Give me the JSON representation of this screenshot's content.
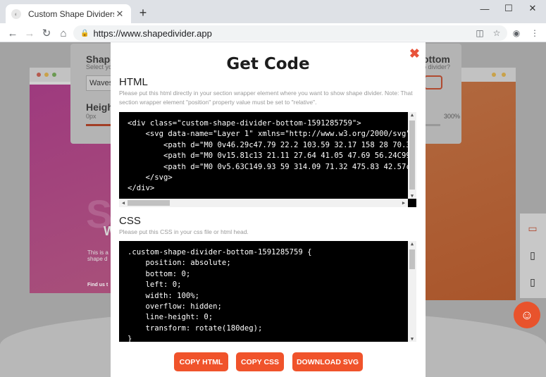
{
  "browser": {
    "tab_title": "Custom Shape Dividers",
    "url": "https://www.shapedivider.app",
    "new_tab_label": "+",
    "close_tab_label": "✕"
  },
  "background": {
    "shape_label": "Shape",
    "select_hint": "Select yo",
    "select_value": "Waves",
    "height_label": "Heigh",
    "height_min": "0px",
    "height_max": "300%",
    "bottom_label": "ottom",
    "bottom_hint": "o divider?",
    "hero_big": "S",
    "hero_w": "W",
    "hero_text": "This is a shape d",
    "hero_find": "Find us t"
  },
  "modal": {
    "title": "Get Code",
    "close_label": "✖",
    "html_heading": "HTML",
    "html_note": "Please put this html directly in your section wrapper element where you want to show shape divider. Note: That section wrapper element \"position\" property value must be set to \"relative\".",
    "html_code": "<div class=\"custom-shape-divider-bottom-1591285759\">\n    <svg data-name=\"Layer 1\" xmlns=\"http://www.w3.org/2000/svg\"\n        <path d=\"M0 0v46.29c47.79 22.2 103.59 32.17 158 28 70.36\n        <path d=\"M0 0v15.81c13 21.11 27.64 41.05 47.69 56.24C99.\n        <path d=\"M0 0v5.63C149.93 59 314.09 71.32 475.83 42.57c4\n    </svg>\n</div>",
    "css_heading": "CSS",
    "css_note": "Please put this CSS in your css file or html head.",
    "css_code": ".custom-shape-divider-bottom-1591285759 {\n    position: absolute;\n    bottom: 0;\n    left: 0;\n    width: 100%;\n    overflow: hidden;\n    line-height: 0;\n    transform: rotate(180deg);\n}",
    "buttons": {
      "copy_html": "COPY HTML",
      "copy_css": "COPY CSS",
      "download_svg": "DOWNLOAD SVG"
    }
  },
  "colors": {
    "accent": "#f0532b",
    "close": "#e8533a",
    "code_bg": "#000000"
  }
}
